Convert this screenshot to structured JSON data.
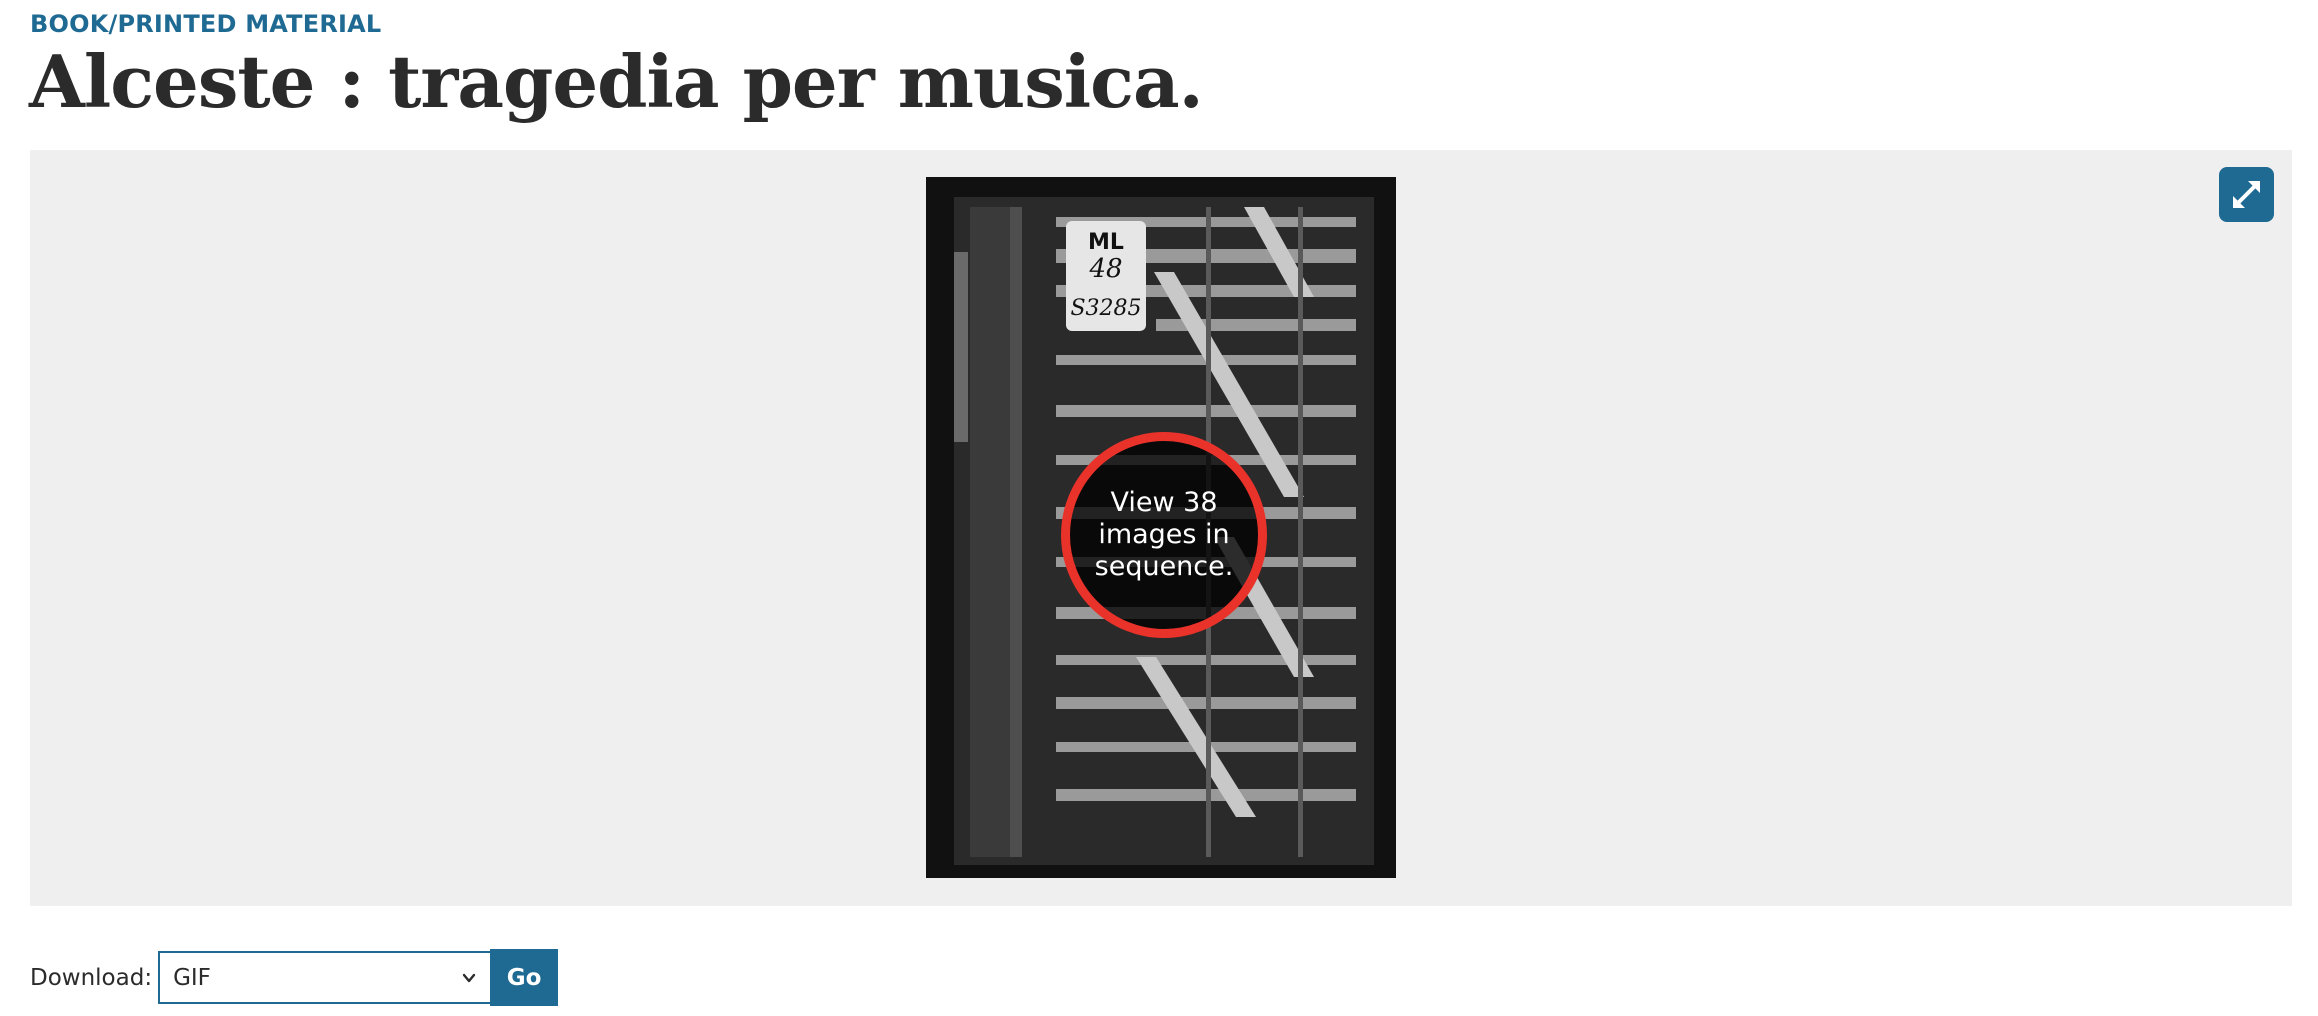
{
  "record": {
    "format": "BOOK/PRINTED MATERIAL",
    "title": "Alceste : tragedia per musica."
  },
  "viewer": {
    "fullscreen_icon": "expand-arrows-icon",
    "thumbnail": {
      "label_lines": [
        "ML",
        "48",
        "S3285"
      ],
      "sequence_text": "View 38 images in sequence."
    }
  },
  "download": {
    "label": "Download:",
    "selected_format": "GIF",
    "button_label": "Go",
    "chevron_icon": "chevron-down-icon"
  },
  "colors": {
    "accent": "#1f6a93",
    "badge_ring": "#e8322a",
    "viewer_bg": "#efefef"
  }
}
